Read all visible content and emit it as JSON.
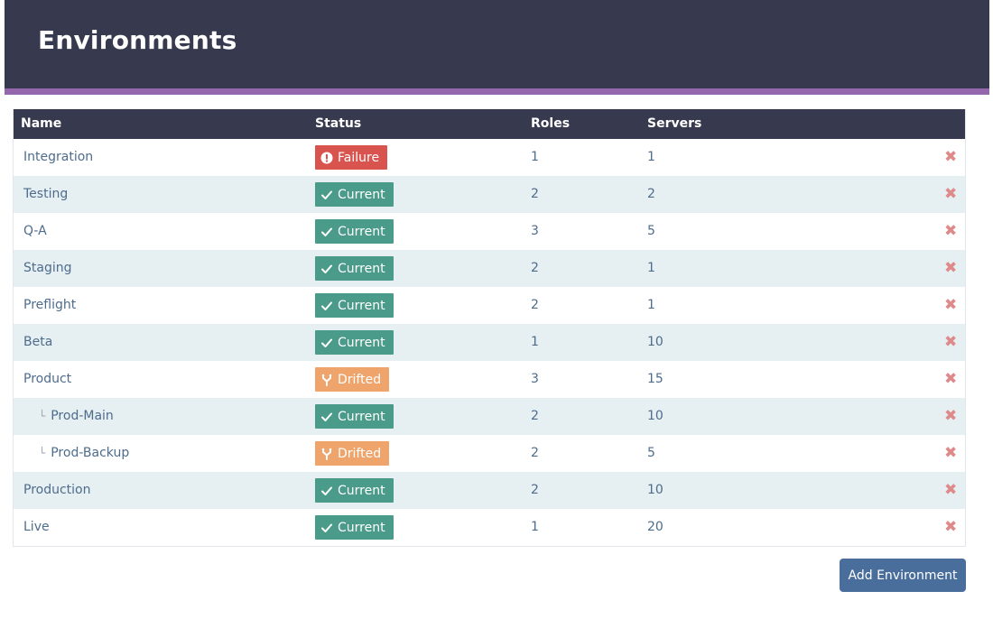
{
  "header": {
    "title": "Environments"
  },
  "table": {
    "columns": {
      "name": "Name",
      "status": "Status",
      "roles": "Roles",
      "servers": "Servers"
    },
    "rows": [
      {
        "name": "Integration",
        "child": false,
        "status": "Failure",
        "status_kind": "failure",
        "roles": "1",
        "servers": "1"
      },
      {
        "name": "Testing",
        "child": false,
        "status": "Current",
        "status_kind": "current",
        "roles": "2",
        "servers": "2"
      },
      {
        "name": "Q-A",
        "child": false,
        "status": "Current",
        "status_kind": "current",
        "roles": "3",
        "servers": "5"
      },
      {
        "name": "Staging",
        "child": false,
        "status": "Current",
        "status_kind": "current",
        "roles": "2",
        "servers": "1"
      },
      {
        "name": "Preflight",
        "child": false,
        "status": "Current",
        "status_kind": "current",
        "roles": "2",
        "servers": "1"
      },
      {
        "name": "Beta",
        "child": false,
        "status": "Current",
        "status_kind": "current",
        "roles": "1",
        "servers": "10"
      },
      {
        "name": "Product",
        "child": false,
        "status": "Drifted",
        "status_kind": "drifted",
        "roles": "3",
        "servers": "15"
      },
      {
        "name": "Prod-Main",
        "child": true,
        "status": "Current",
        "status_kind": "current",
        "roles": "2",
        "servers": "10"
      },
      {
        "name": "Prod-Backup",
        "child": true,
        "status": "Drifted",
        "status_kind": "drifted",
        "roles": "2",
        "servers": "5"
      },
      {
        "name": "Production",
        "child": false,
        "status": "Current",
        "status_kind": "current",
        "roles": "2",
        "servers": "10"
      },
      {
        "name": "Live",
        "child": false,
        "status": "Current",
        "status_kind": "current",
        "roles": "1",
        "servers": "20"
      }
    ],
    "tree_glyph": "└",
    "delete_glyph": "✖"
  },
  "actions": {
    "add_label": "Add Environment"
  },
  "icons": {
    "current": "check-icon",
    "failure": "alert-circle-icon",
    "drifted": "fork-icon",
    "delete": "close-icon"
  },
  "colors": {
    "header_bg": "#373a4f",
    "accent": "#9466ac",
    "current": "#4a9b8a",
    "failure": "#d9534f",
    "drifted": "#eea46b",
    "button": "#4a6e9c"
  }
}
